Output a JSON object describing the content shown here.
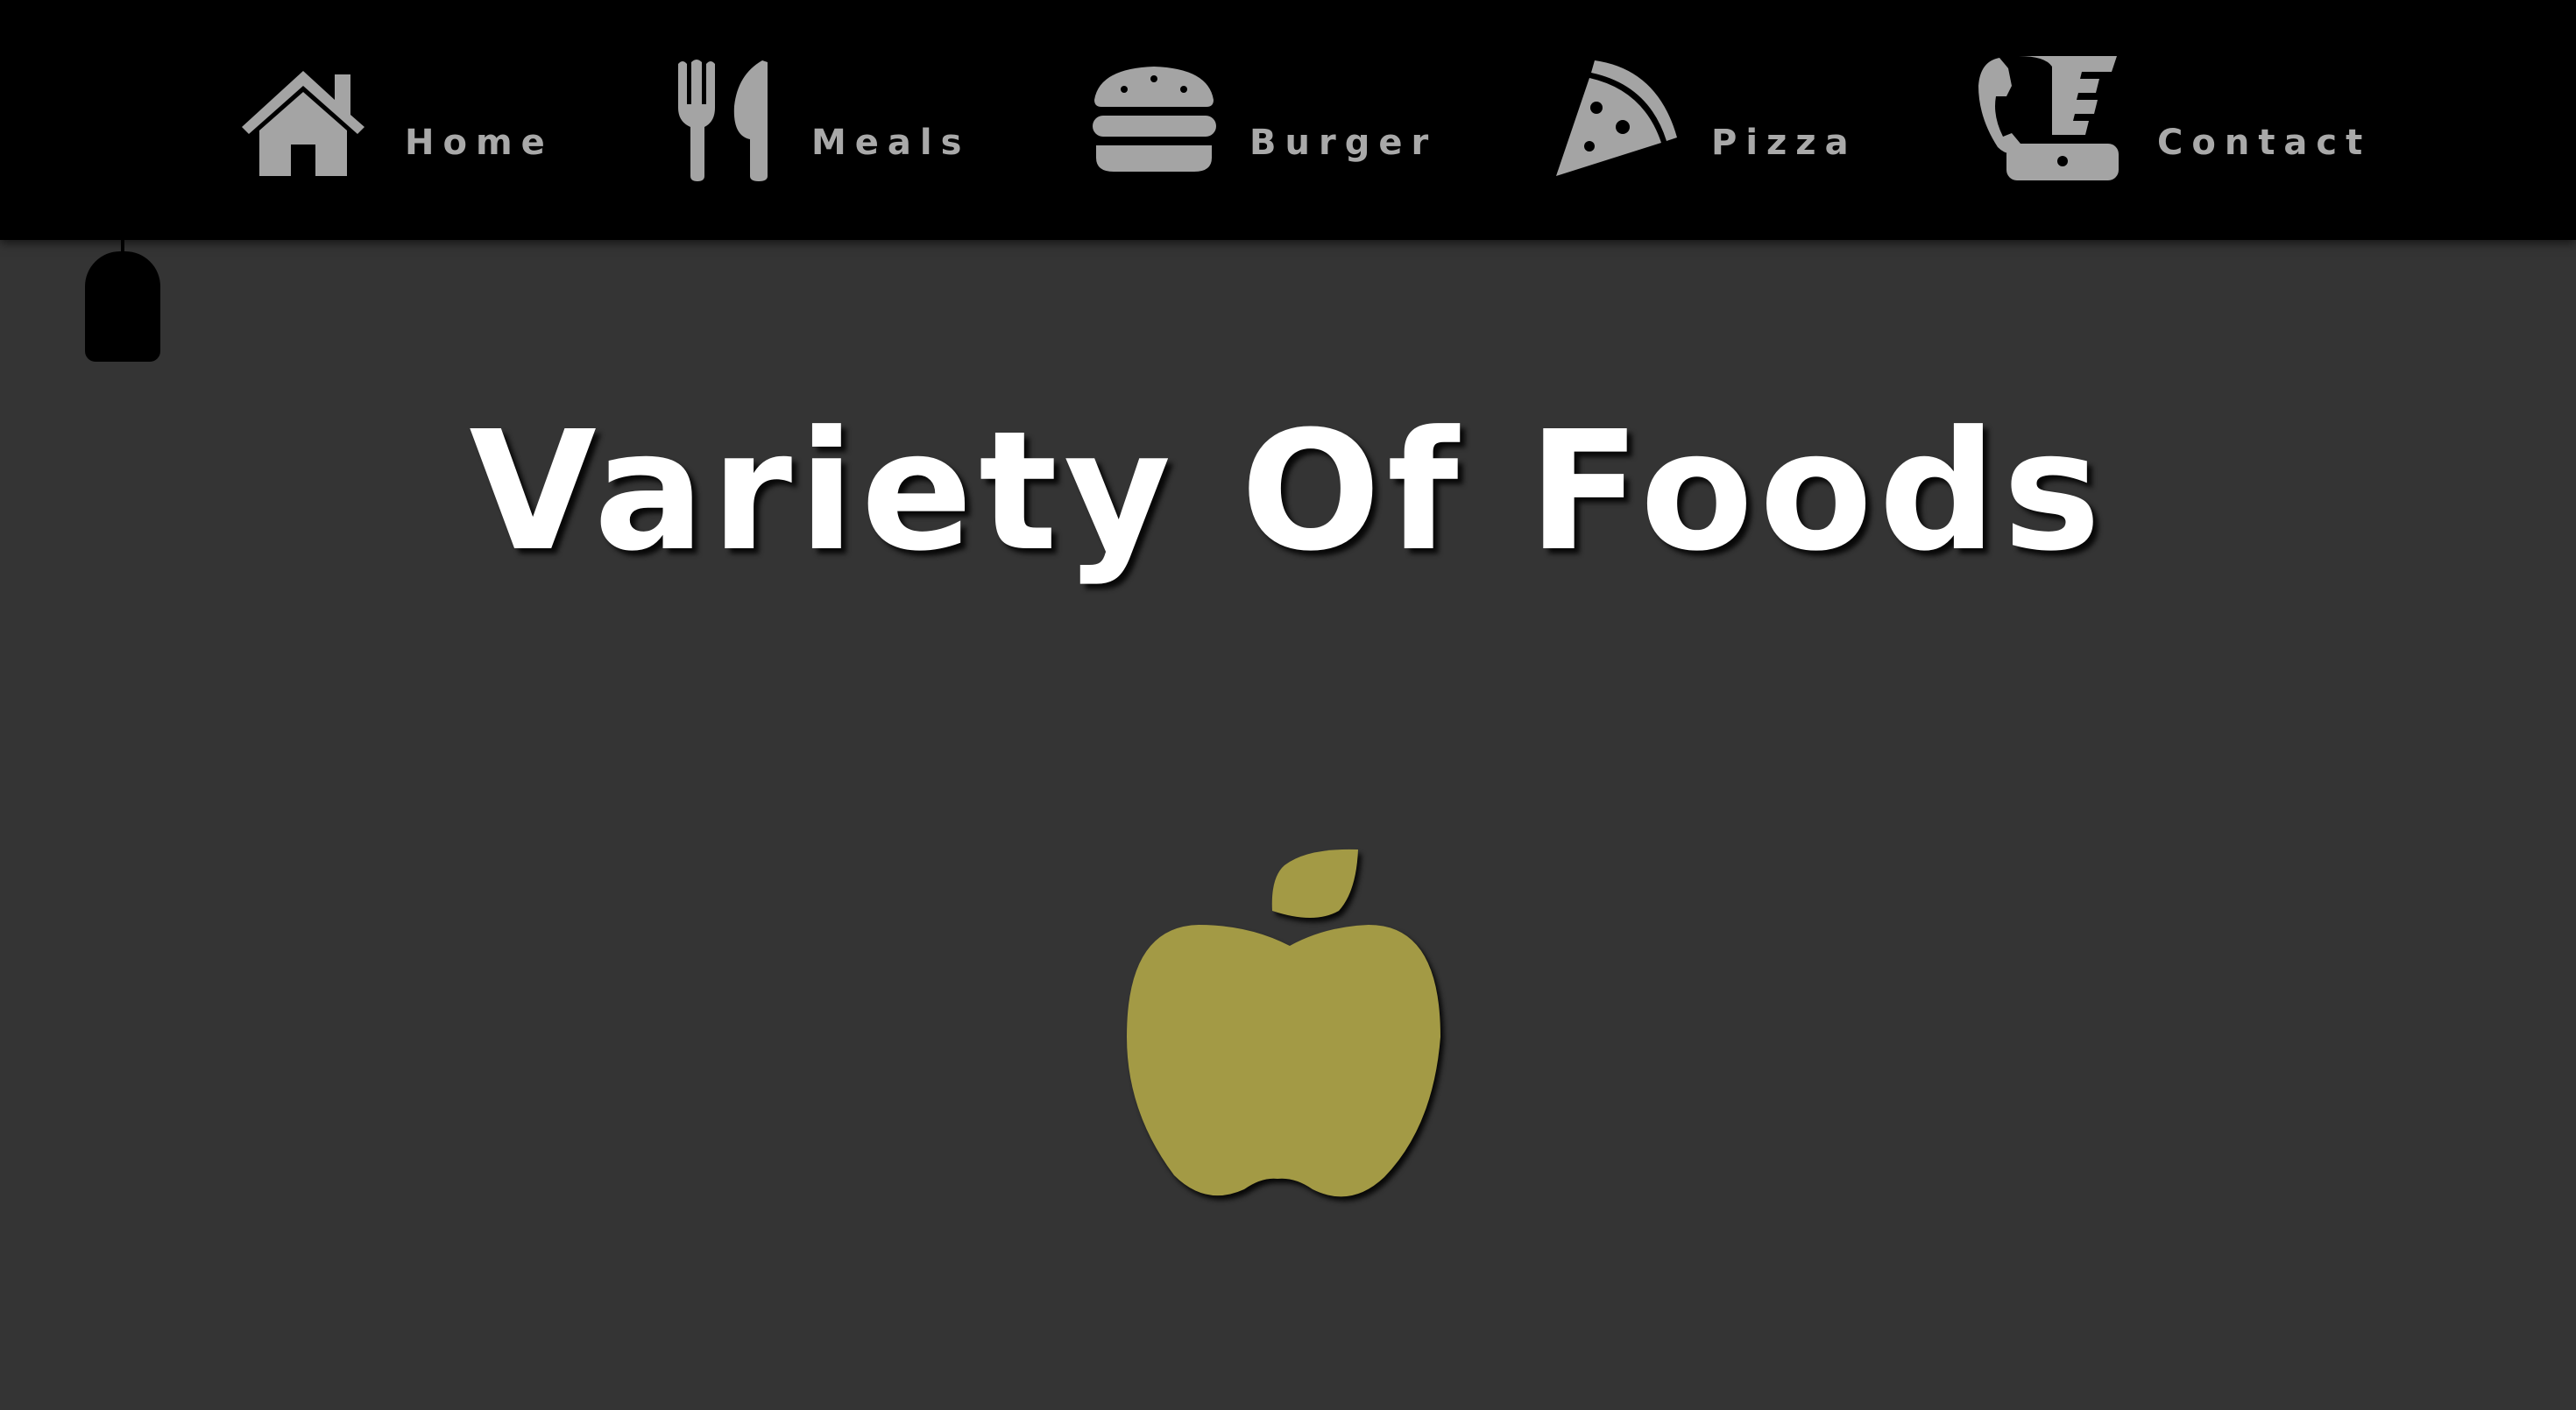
{
  "nav": {
    "items": [
      {
        "label": "Home",
        "icon": "house-icon"
      },
      {
        "label": "Meals",
        "icon": "fork-knife-icon"
      },
      {
        "label": "Burger",
        "icon": "burger-icon"
      },
      {
        "label": "Pizza",
        "icon": "pizza-slice-icon"
      },
      {
        "label": "Contact",
        "icon": "phone-fax-icon"
      }
    ]
  },
  "main": {
    "title": "Variety Of Foods",
    "hero_icon": "apple-icon"
  },
  "colors": {
    "navbar_bg": "#000000",
    "page_bg": "#343434",
    "nav_icon": "#a4a4a4",
    "title": "#ffffff",
    "apple": "#a39a45"
  }
}
